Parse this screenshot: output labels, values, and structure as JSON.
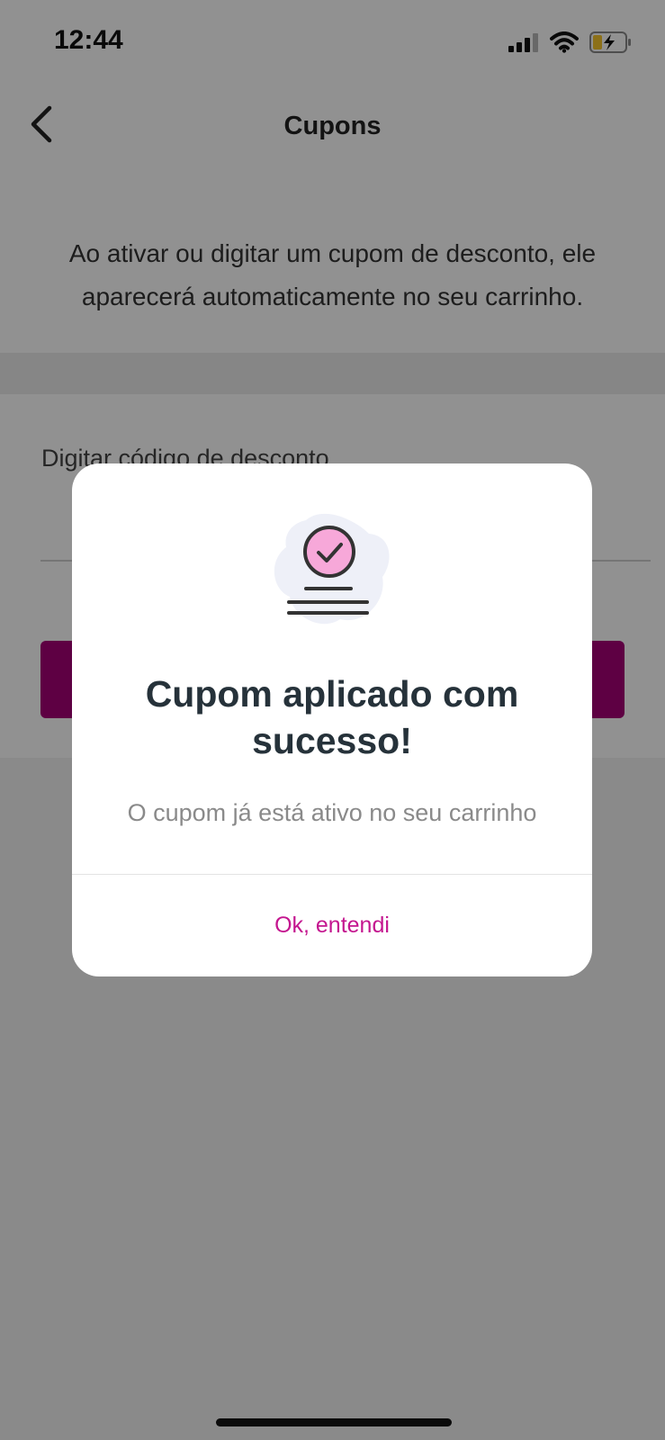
{
  "status_bar": {
    "time": "12:44",
    "icons": [
      "cellular-signal-icon",
      "wifi-icon",
      "battery-charging-icon"
    ]
  },
  "header": {
    "title": "Cupons",
    "back_icon": "chevron-left-icon"
  },
  "info": {
    "text": "Ao ativar ou digitar um cupom de desconto, ele aparecerá automaticamente no seu carrinho."
  },
  "coupon_form": {
    "input_label": "Digitar código de desconto",
    "button_color": "#a50077"
  },
  "modal": {
    "illustration_icon": "coupon-success-icon",
    "title": "Cupom aplicado com sucesso!",
    "message": "O cupom já está ativo no seu carrinho",
    "ok_label": "Ok, entendi",
    "accent_color": "#c4168f"
  }
}
